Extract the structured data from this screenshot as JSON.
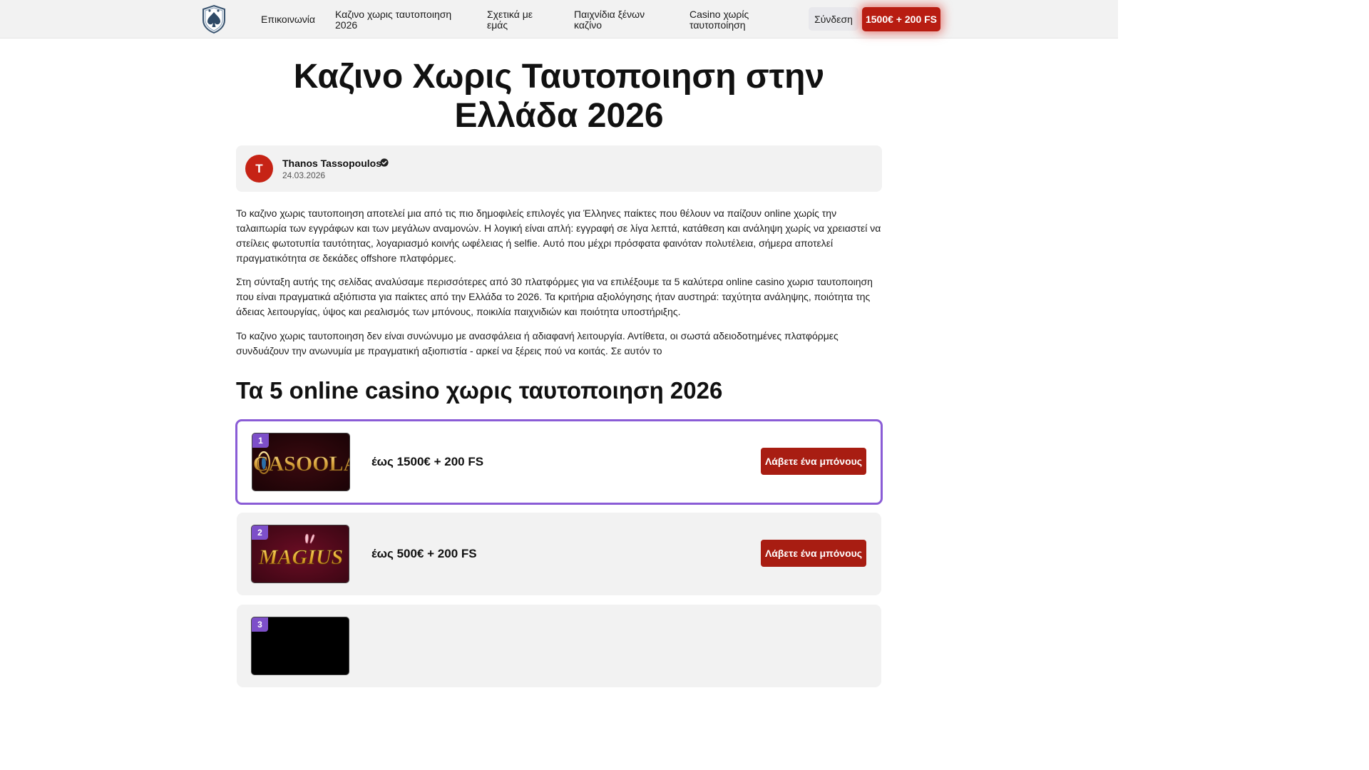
{
  "header": {
    "nav": [
      {
        "label": "Επικοινωνία"
      },
      {
        "label": "Καζινο χωρις ταυτοποιηση 2026"
      },
      {
        "label": "Σχετικά με εμάς"
      },
      {
        "label": "Παιχνίδια ξένων καζίνο"
      },
      {
        "label": "Casino χωρίς ταυτοποίηση"
      }
    ],
    "login_label": "Σύνδεση",
    "bonus_label": "1500€ + 200 FS"
  },
  "page": {
    "title": "Καζινο Χωρις Ταυτοποιηση στην Ελλάδα 2026",
    "author": {
      "initial": "T",
      "name": "Thanos Tassopoulos",
      "date": "24.03.2026"
    },
    "paragraphs": [
      "Το καζινο χωρις ταυτοποιηση αποτελεί μια από τις πιο δημοφιλείς επιλογές για Έλληνες παίκτες που θέλουν να παίζουν online χωρίς την ταλαιπωρία των εγγράφων και των μεγάλων αναμονών. Η λογική είναι απλή: εγγραφή σε λίγα λεπτά, κατάθεση και ανάληψη χωρίς να χρειαστεί να στείλεις φωτοτυπία ταυτότητας, λογαριασμό κοινής ωφέλειας ή selfie. Αυτό που μέχρι πρόσφατα φαινόταν πολυτέλεια, σήμερα αποτελεί πραγματικότητα σε δεκάδες offshore πλατφόρμες.",
      "Στη σύνταξη αυτής της σελίδας αναλύσαμε περισσότερες από 30 πλατφόρμες για να επιλέξουμε τα 5 καλύτερα online casino χωρισ ταυτοποιηση που είναι πραγματικά αξιόπιστα για παίκτες από την Ελλάδα το 2026. Τα κριτήρια αξιολόγησης ήταν αυστηρά: ταχύτητα ανάληψης, ποιότητα της άδειας λειτουργίας, ύψος και ρεαλισμός των μπόνους, ποικιλία παιχνιδιών και ποιότητα υποστήριξης.",
      "Το καζινο χωρις ταυτοποιηση δεν είναι συνώνυμο με ανασφάλεια ή αδιαφανή λειτουργία. Αντίθετα, οι σωστά αδειοδοτημένες πλατφόρμες συνδυάζουν την ανωνυμία με πραγματική αξιοπιστία - αρκεί να ξέρεις πού να κοιτάς. Σε αυτόν το"
    ],
    "section_title": "Τα 5 online casino χωρις ταυτοποιηση 2026"
  },
  "casinos": [
    {
      "rank": "1",
      "logo_text": "CASOOLA",
      "bonus": "έως 1500€ + 200 FS",
      "cta": "Λάβετε ένα μπόνους"
    },
    {
      "rank": "2",
      "logo_text": "MAGIUS",
      "bonus": "έως 500€ + 200 FS",
      "cta": "Λάβετε ένα μπόνους"
    },
    {
      "rank": "3"
    }
  ],
  "colors": {
    "accent_red": "#b81d12",
    "featured_border": "#8a5cd6",
    "rank_badge": "#7d4fc9"
  }
}
